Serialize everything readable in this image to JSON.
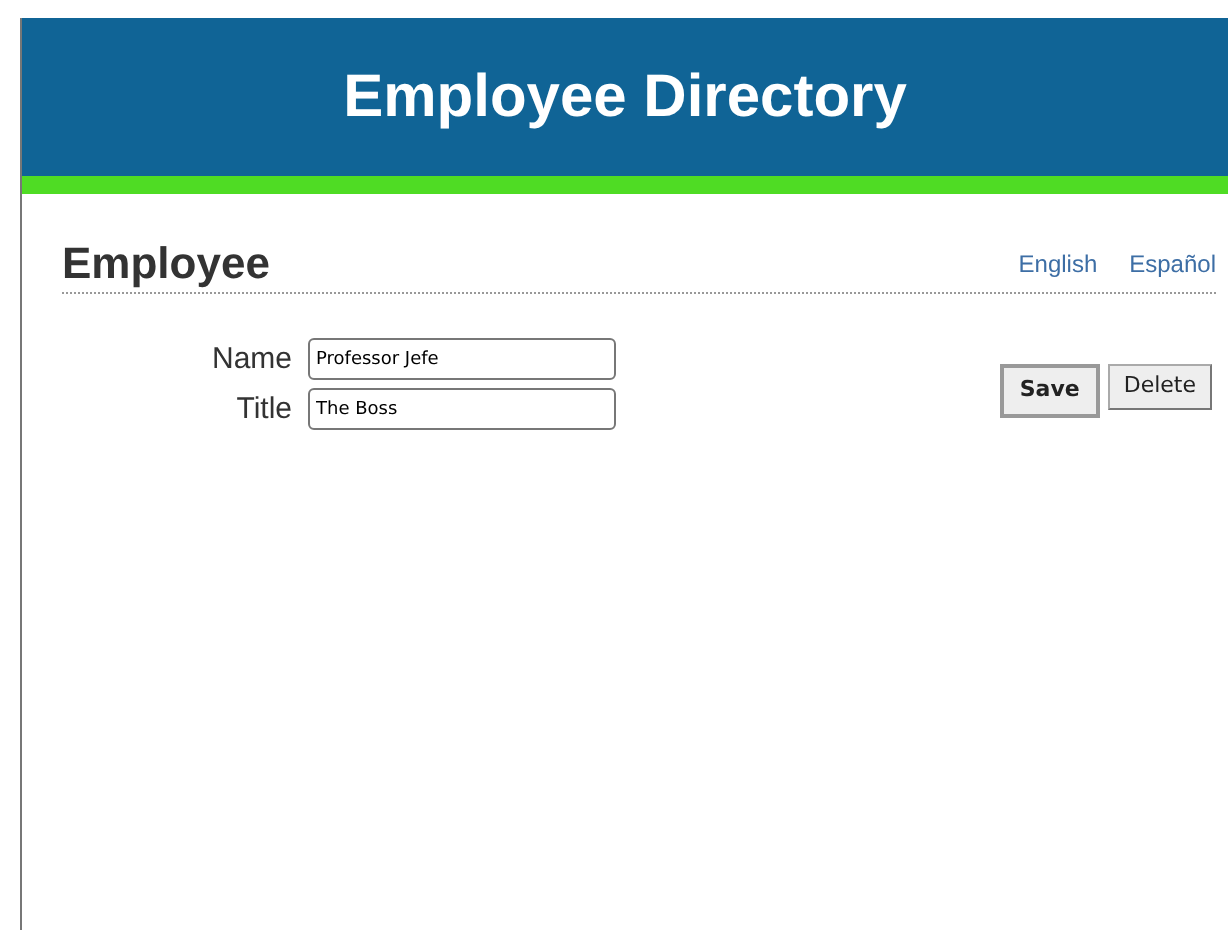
{
  "header": {
    "title": "Employee Directory"
  },
  "section": {
    "title": "Employee"
  },
  "languages": [
    {
      "label": "English"
    },
    {
      "label": "Español"
    }
  ],
  "fields": [
    {
      "label": "Name",
      "value": "Professor Jefe"
    },
    {
      "label": "Title",
      "value": "The Boss"
    }
  ],
  "buttons": [
    {
      "label": "Save",
      "default": true
    },
    {
      "label": "Delete",
      "default": false
    }
  ]
}
